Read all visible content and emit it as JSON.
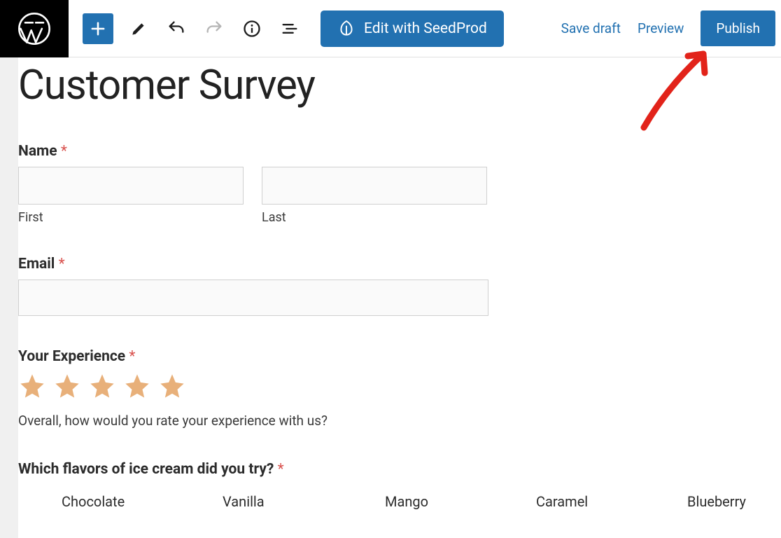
{
  "toolbar": {
    "seedprod_label": "Edit with SeedProd",
    "save_draft": "Save draft",
    "preview": "Preview",
    "publish": "Publish"
  },
  "page": {
    "title": "Customer Survey"
  },
  "form": {
    "name": {
      "label": "Name",
      "first_sublabel": "First",
      "last_sublabel": "Last"
    },
    "email": {
      "label": "Email"
    },
    "experience": {
      "label": "Your Experience",
      "description": "Overall, how would you rate your experience with us?"
    },
    "flavors": {
      "label": "Which flavors of ice cream did you try?",
      "options": [
        "Chocolate",
        "Vanilla",
        "Mango",
        "Caramel",
        "Blueberry"
      ]
    },
    "required_marker": "*"
  }
}
